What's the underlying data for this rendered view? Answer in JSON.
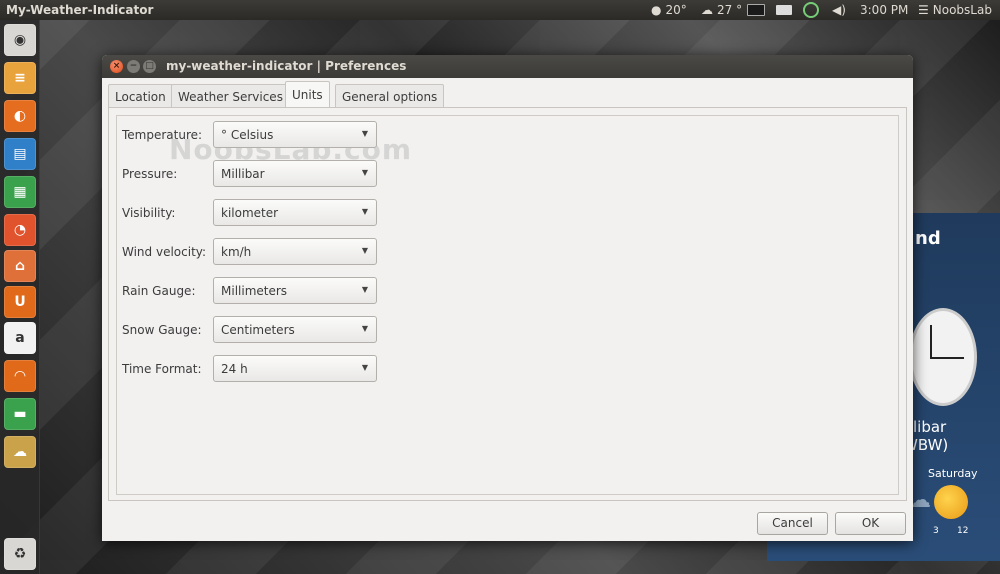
{
  "top_panel": {
    "app_title": "My-Weather-Indicator",
    "temp1": "20°",
    "temp2": "27 °",
    "time": "3:00 PM",
    "user": "NoobsLab"
  },
  "launcher": {
    "items": [
      {
        "name": "dash-home-icon",
        "glyph": "◉",
        "bg": "#d9d7d3"
      },
      {
        "name": "notes-app-icon",
        "glyph": "≡",
        "bg": "#e8a33d"
      },
      {
        "name": "firefox-icon",
        "glyph": "◐",
        "bg": "#e56d1f"
      },
      {
        "name": "writer-icon",
        "glyph": "▤",
        "bg": "#2f7fc9"
      },
      {
        "name": "calc-icon",
        "glyph": "▦",
        "bg": "#3aa14c"
      },
      {
        "name": "impress-icon",
        "glyph": "◔",
        "bg": "#e0532c"
      },
      {
        "name": "software-center-icon",
        "glyph": "⌂",
        "bg": "#e0703a"
      },
      {
        "name": "ubuntu-one-icon",
        "glyph": "U",
        "bg": "#e06a1a"
      },
      {
        "name": "amazon-icon",
        "glyph": "a",
        "bg": "#f2f2f2"
      },
      {
        "name": "music-player-icon",
        "glyph": "◠",
        "bg": "#e06a1a"
      },
      {
        "name": "toggle-app-icon",
        "glyph": "▬",
        "bg": "#3aa14c"
      },
      {
        "name": "weather-indicator-icon",
        "glyph": "☁",
        "bg": "#c9a24a"
      },
      {
        "name": "trash-icon",
        "glyph": "♻",
        "bg": "#d9d7d3"
      }
    ]
  },
  "bg_widget": {
    "heading": "nd",
    "pressure_partial": "libar",
    "wind_partial": "WBW)",
    "day": "Saturday",
    "num1": "3",
    "num2": "12"
  },
  "dialog": {
    "title": "my-weather-indicator | Preferences",
    "tabs": [
      {
        "label": "Location"
      },
      {
        "label": "Weather Services"
      },
      {
        "label": "Units"
      },
      {
        "label": "General options"
      }
    ],
    "watermark": "NoobsLab.com",
    "rows": [
      {
        "label": "Temperature:",
        "value": "° Celsius"
      },
      {
        "label": "Pressure:",
        "value": "Millibar"
      },
      {
        "label": "Visibility:",
        "value": "kilometer"
      },
      {
        "label": "Wind velocity:",
        "value": "km/h"
      },
      {
        "label": "Rain Gauge:",
        "value": "Millimeters"
      },
      {
        "label": "Snow Gauge:",
        "value": "Centimeters"
      },
      {
        "label": "Time Format:",
        "value": "24 h"
      }
    ],
    "cancel_label": "Cancel",
    "ok_label": "OK"
  }
}
